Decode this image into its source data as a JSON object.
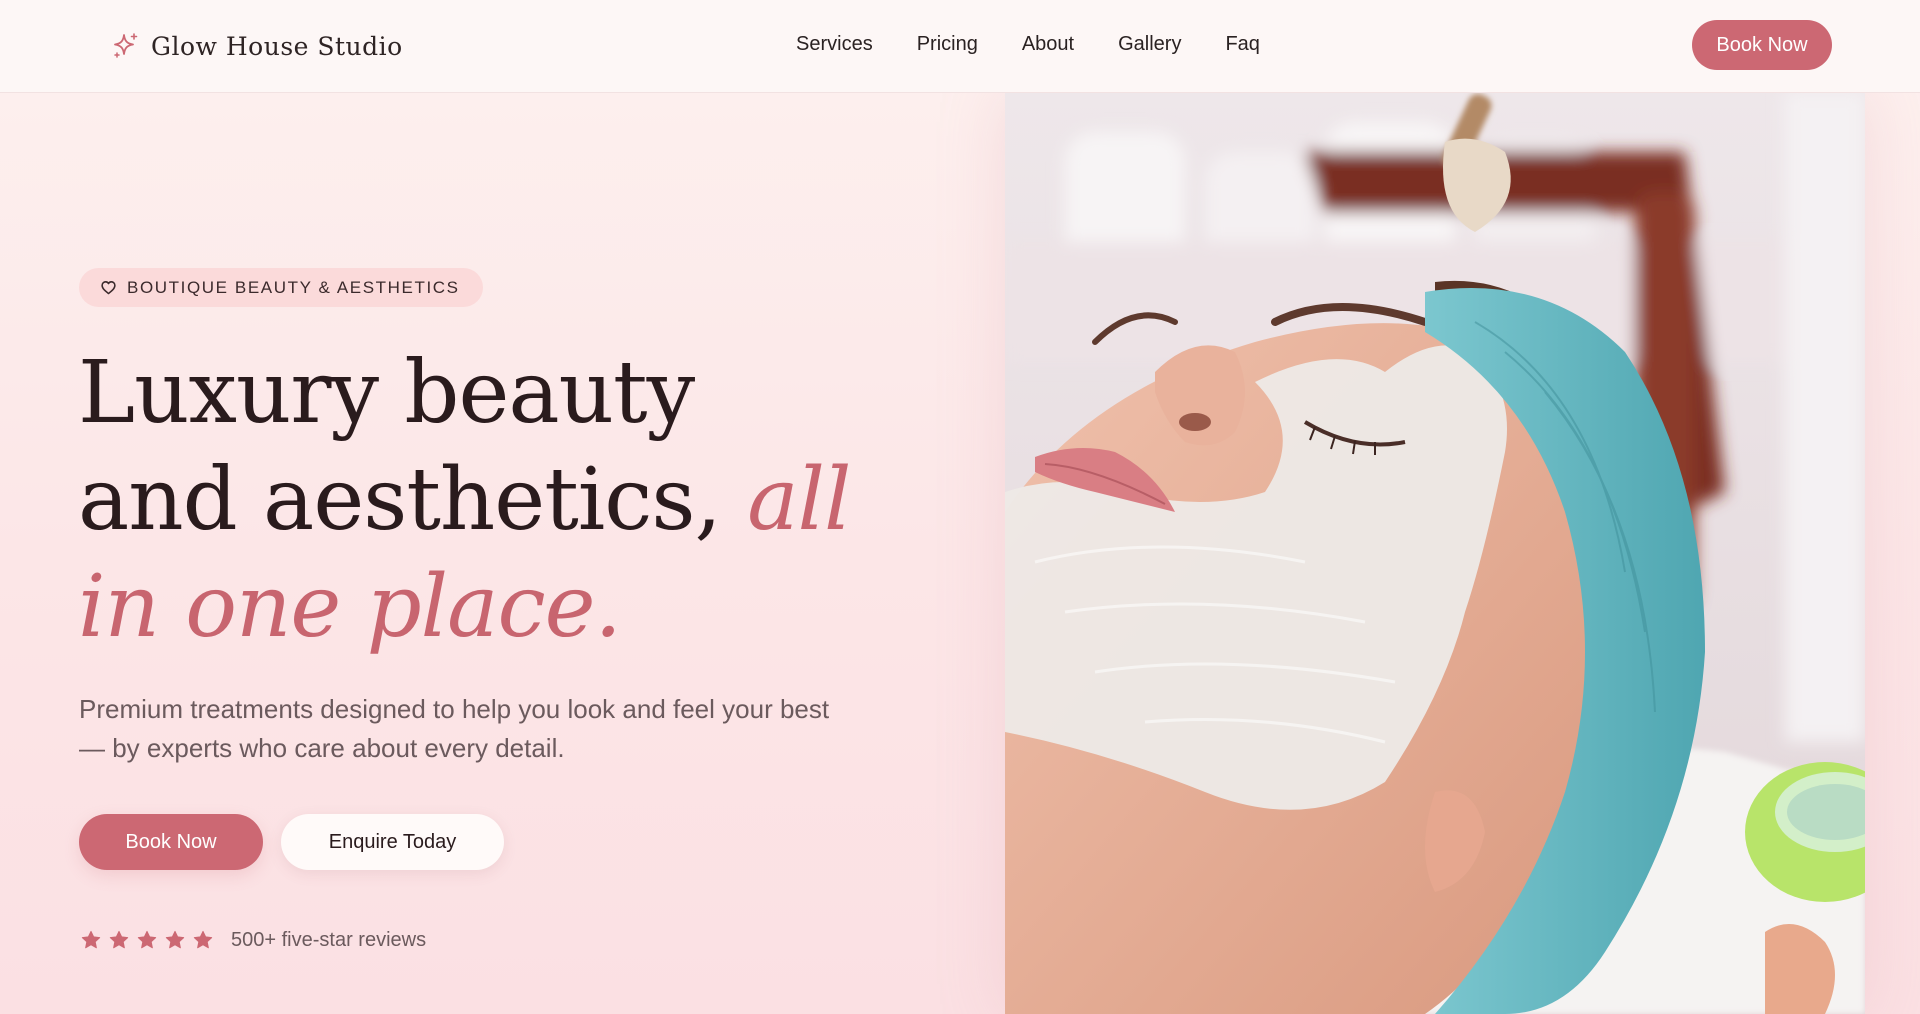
{
  "nav": {
    "brand_name": "Glow House Studio",
    "links": [
      "Services",
      "Pricing",
      "About",
      "Gallery",
      "Faq"
    ],
    "cta_label": "Book Now"
  },
  "hero": {
    "badge": "BOUTIQUE BEAUTY & AESTHETICS",
    "headline_part1": "Luxury beauty and aesthetics,",
    "headline_accent": "all in one place.",
    "subtext": "Premium treatments designed to help you look and feel your best — by experts who care about every detail.",
    "primary_button": "Book Now",
    "secondary_button": "Enquire Today",
    "rating_value": 5,
    "rating_max": 5,
    "rating_text": "500+ five-star reviews"
  },
  "icons": {
    "brand": "sparkle-icon",
    "badge": "heart-icon",
    "rating": "star-icon"
  },
  "colors": {
    "accent": "#cc6873",
    "accent_text": "#c8656f",
    "heading": "#2a1b1d",
    "body_text": "#6b5a5d",
    "background": "#fce6e7",
    "badge_bg": "#fbdada"
  }
}
